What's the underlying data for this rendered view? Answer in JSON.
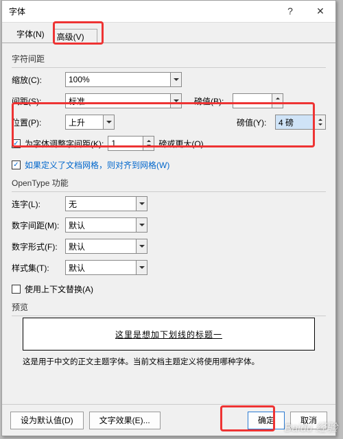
{
  "title": "字体",
  "tabs": {
    "font": "字体(N)",
    "advanced": "高级(V)"
  },
  "spacing": {
    "legend": "字符间距",
    "scale": {
      "label": "缩放(C):",
      "value": "100%"
    },
    "spacingType": {
      "label": "间距(S):",
      "value": "标准",
      "ptLabel": "磅值(B):",
      "ptValue": ""
    },
    "position": {
      "label": "位置(P):",
      "value": "上升",
      "ptLabel": "磅值(Y):",
      "ptValue": "4 磅"
    },
    "kern": {
      "label": "为字体调整字间距(K):",
      "value": "1",
      "suffix": "磅或更大(O)"
    },
    "grid": {
      "label": "如果定义了文档网格，则对齐到网格(W)"
    }
  },
  "ot": {
    "legend": "OpenType 功能",
    "lig": {
      "label": "连字(L):",
      "value": "无"
    },
    "nums": {
      "label": "数字间距(M):",
      "value": "默认"
    },
    "form": {
      "label": "数字形式(F):",
      "value": "默认"
    },
    "sset": {
      "label": "样式集(T):",
      "value": "默认"
    },
    "ctx": {
      "label": "使用上下文替换(A)"
    }
  },
  "preview": {
    "legend": "预览",
    "sample": "这里是想加下划线的标题一",
    "note": "这是用于中文的正文主题字体。当前文档主题定义将使用哪种字体。"
  },
  "buttons": {
    "default": "设为默认值(D)",
    "effects": "文字效果(E)...",
    "ok": "确定",
    "cancel": "取消"
  },
  "watermark": "Baidu 经验"
}
